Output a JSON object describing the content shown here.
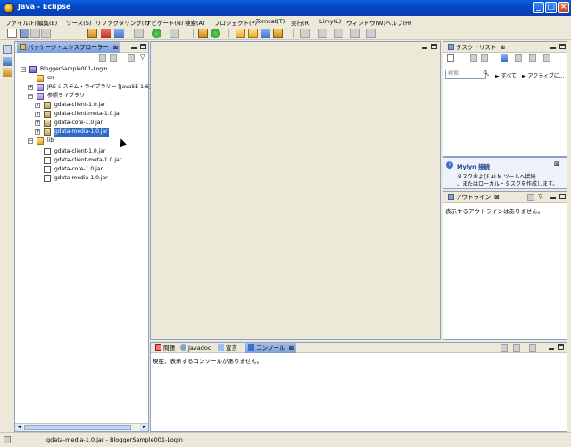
{
  "window": {
    "title": "Java - Eclipse"
  },
  "menu": [
    "ファイル(F)",
    "編集(E)",
    "ソース(S)",
    "リファクタリング(T)",
    "ナビゲート(N)",
    "検索(A)",
    "プロジェクト(P)",
    "Tomcat(T)",
    "実行(R)",
    "Limy(L)",
    "ウィンドウ(W)",
    "ヘルプ(H)"
  ],
  "package_explorer": {
    "tab_label": "パッケージ・エクスプローラー",
    "tree": {
      "project": "BloggerSample001-Login",
      "src": "src",
      "jre": "JRE システム・ライブラリー [JavaSE-1.6]",
      "ref_libs": "参照ライブラリー",
      "ref_jars": [
        "gdata-client-1.0.jar",
        "gdata-client-meta-1.0.jar",
        "gdata-core-1.0.jar",
        "gdata-media-1.0.jar"
      ],
      "lib": "lib",
      "lib_jars": [
        "gdata-client-1.0.jar",
        "gdata-client-meta-1.0.jar",
        "gdata-core-1.0.jar",
        "gdata-media-1.0.jar"
      ]
    }
  },
  "task_list": {
    "tab_label": "タスク・リスト",
    "search_placeholder": "検索",
    "filter_all": "► すべて",
    "filter_active": "► アクティブに..."
  },
  "mylyn": {
    "title": "Mylyn 接続",
    "line1": "タスクおよび ALM ツールへ接続",
    "line2": "、またはローカル・タスクを作成します。"
  },
  "outline": {
    "tab_label": "アウトライン",
    "message": "表示するアウトラインはありません。"
  },
  "bottom_tabs": {
    "problems": "問題",
    "javadoc": "Javadoc",
    "declaration": "宣言",
    "console": "コンソール"
  },
  "console": {
    "message": "現在、表示するコンソールがありません。"
  },
  "status": {
    "text": "gdata-media-1.0.jar - BloggerSample001-Login"
  }
}
